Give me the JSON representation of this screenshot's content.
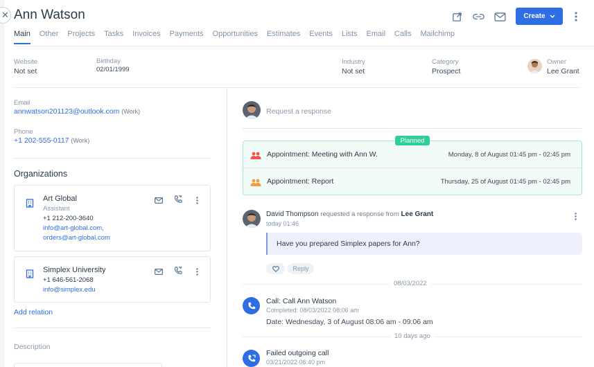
{
  "header": {
    "title": "Ann Watson",
    "create_label": "Create",
    "accent": "#2e6de3"
  },
  "tabs": [
    "Main",
    "Other",
    "Projects",
    "Tasks",
    "Invoices",
    "Payments",
    "Opportunities",
    "Estimates",
    "Events",
    "Lists",
    "Email",
    "Calls",
    "Mailchimp"
  ],
  "info": {
    "website_label": "Website",
    "website_value": "Not set",
    "birthday_label": "Birthday",
    "birthday_value": "02/01/1999",
    "industry_label": "Industry",
    "industry_value": "Not set",
    "category_label": "Category",
    "category_value": "Prospect",
    "owner_label": "Owner",
    "owner_value": "Lee Grant"
  },
  "contact": {
    "email_label": "Email",
    "email_value": "annwatson201123@outlook.com",
    "email_note": "(Work)",
    "phone_label": "Phone",
    "phone_value": "+1 202-555-0117",
    "phone_note": "(Work)"
  },
  "organizations": {
    "title": "Organizations",
    "items": [
      {
        "name": "Art Global",
        "role": "Assistant",
        "phone": "+1 212-200-3640",
        "email1": "info@art-global.com,",
        "email2": "orders@art-global.com"
      },
      {
        "name": "Simplex University",
        "phone": "+1 646-561-2068",
        "email1": "info@simplex.edu"
      }
    ],
    "add_relation": "Add relation"
  },
  "description_label": "Description",
  "feed": {
    "request_placeholder": "Request a response",
    "planned_badge": "Planned",
    "appointments": [
      {
        "title": "Appointment: Meeting with Ann W.",
        "date": "Monday, 8 of August 01:45 pm - 02:45 pm",
        "icon_color": "#f0544f"
      },
      {
        "title": "Appointment: Report",
        "date": "Thursday, 25 of August 01:45 pm - 02:45 pm",
        "icon_color": "#f59a3d"
      }
    ],
    "request": {
      "author": "David Thompson",
      "middle": "requested a response from",
      "target": "Lee Grant",
      "time": "today 01:46",
      "message": "Have you prepared Simplex papers for Ann?",
      "reply_label": "Reply"
    },
    "date_divider_1": "08/03/2022",
    "call": {
      "title": "Call: Call Ann Watson",
      "completed": "Completed: 08/03/2022 08:06 am",
      "date_line": "Date: Wednesday, 3 of August 08:06 am - 09:06 am"
    },
    "date_divider_2": "10 days ago",
    "failed_call": {
      "title": "Failed outgoing call",
      "time": "03/21/2022 06:40 pm"
    }
  }
}
